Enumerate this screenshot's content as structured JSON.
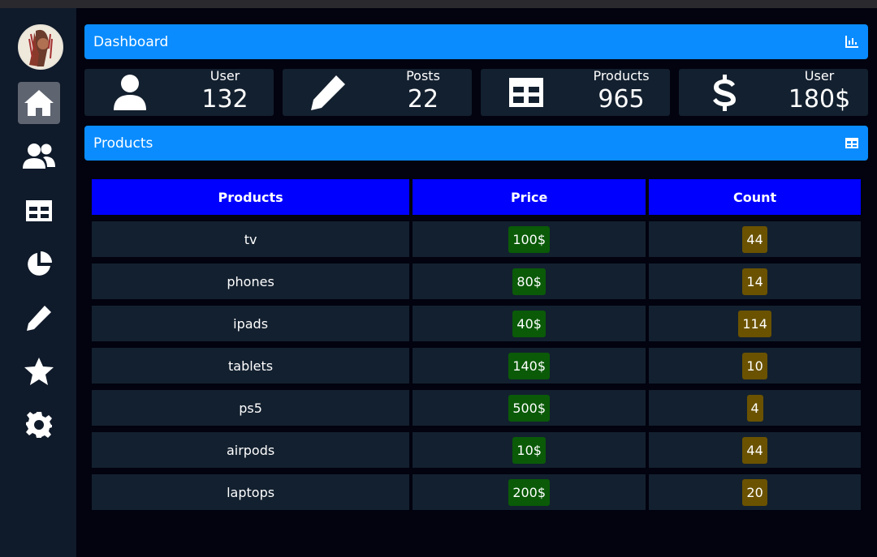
{
  "header": {
    "title": "Dashboard"
  },
  "stats": [
    {
      "label": "User",
      "value": "132",
      "icon": "user-icon"
    },
    {
      "label": "Posts",
      "value": "22",
      "icon": "pencil-icon"
    },
    {
      "label": "Products",
      "value": "965",
      "icon": "table-icon"
    },
    {
      "label": "User",
      "value": "180$",
      "icon": "dollar-icon"
    }
  ],
  "products_panel": {
    "title": "Products"
  },
  "table": {
    "columns": [
      "Products",
      "Price",
      "Count"
    ],
    "rows": [
      {
        "name": "tv",
        "price": "100$",
        "count": "44"
      },
      {
        "name": "phones",
        "price": "80$",
        "count": "14"
      },
      {
        "name": "ipads",
        "price": "40$",
        "count": "114"
      },
      {
        "name": "tablets",
        "price": "140$",
        "count": "10"
      },
      {
        "name": "ps5",
        "price": "500$",
        "count": "4"
      },
      {
        "name": "airpods",
        "price": "10$",
        "count": "44"
      },
      {
        "name": "laptops",
        "price": "200$",
        "count": "20"
      }
    ]
  },
  "sidebar": {
    "items": [
      {
        "icon": "home-icon",
        "active": true
      },
      {
        "icon": "users-icon",
        "active": false
      },
      {
        "icon": "table-icon",
        "active": false
      },
      {
        "icon": "pie-chart-icon",
        "active": false
      },
      {
        "icon": "pencil-icon",
        "active": false
      },
      {
        "icon": "star-icon",
        "active": false
      },
      {
        "icon": "gear-icon",
        "active": false
      }
    ]
  },
  "colors": {
    "accent": "#0a8cff",
    "table_header": "#0000ff",
    "price_badge": "#0a5a08",
    "count_badge": "#6a5200",
    "background": "#02030f",
    "sidebar": "#0f1a2a",
    "card": "#13202f"
  }
}
